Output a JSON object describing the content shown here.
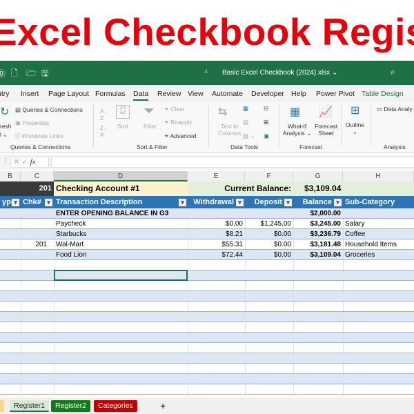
{
  "banner": {
    "title": "Excel Checkbook Register"
  },
  "titlebar": {
    "filename": "Basic Excel Checkbook (2024).xlsx ⌄",
    "search_icon": "search-icon"
  },
  "menu": [
    "ntry",
    "Insert",
    "Page Layout",
    "Formulas",
    "Data",
    "Review",
    "View",
    "Automate",
    "Developer",
    "Help",
    "Power Pivot",
    "Table Design"
  ],
  "ribbon": {
    "refresh": "resh",
    "refresh2": "l ⌄",
    "queries": "Queries & Connections",
    "properties": "Properties",
    "workbook_links": "Workbook Links",
    "group_queries": "Queries & Connections",
    "sort": "Sort",
    "filter": "Filter",
    "clear": "Clear",
    "reapply": "Reapply",
    "advanced": "Advanced",
    "group_sort": "Sort & Filter",
    "text_to": "Text to",
    "columns": "Columns",
    "group_data_tools": "Data Tools",
    "whatif1": "What-If",
    "whatif2": "Analysis ⌄",
    "forecast1": "Forecast",
    "forecast2": "Sheet",
    "group_forecast": "Forecast",
    "outline": "Outline",
    "outline_caret": "⌄",
    "data_analysis": "Data Analy",
    "group_analysis": "Analysis"
  },
  "formula": {
    "fx": "fx",
    "value": ""
  },
  "columns": [
    "B",
    "C",
    "D",
    "E",
    "F",
    "G",
    "H"
  ],
  "row1": {
    "chk": "201",
    "account": "Checking Account #1",
    "balance_label": "Current Balance:",
    "balance": "$3,109.04"
  },
  "headers": [
    "ype",
    "Chk#",
    "Transaction Description",
    "Withdrawal",
    "Deposit",
    "Balance",
    "Sub-Category"
  ],
  "rows": [
    {
      "chk": "",
      "desc": "ENTER OPENING BALANCE IN G3",
      "w": "",
      "d": "",
      "bal": "$2,000.00",
      "sub": ""
    },
    {
      "chk": "",
      "desc": "Paycheck",
      "w": "$0.00",
      "d": "$1,245.00",
      "bal": "$3,245.00",
      "sub": "Salary"
    },
    {
      "chk": "",
      "desc": "Starbucks",
      "w": "$8.21",
      "d": "$0.00",
      "bal": "$3,236.79",
      "sub": "Coffee"
    },
    {
      "chk": "201",
      "desc": "Wal-Mart",
      "w": "$55.31",
      "d": "$0.00",
      "bal": "$3,181.48",
      "sub": "Household Items"
    },
    {
      "chk": "",
      "desc": "Food Lion",
      "w": "$72.44",
      "d": "$0.00",
      "bal": "$3,109.04",
      "sub": "Groceries"
    }
  ],
  "sheet_tabs": [
    {
      "label": "Register1",
      "color": "#d6ead6"
    },
    {
      "label": "Register2",
      "color": "#0f7b1b"
    },
    {
      "label": "Categories",
      "color": "#c00000"
    }
  ],
  "add_sheet": "+",
  "colors": {
    "header_blue": "#2e75b6",
    "band": "#dde7f3",
    "title_red": "#e8000b",
    "excel_green": "#1e7145"
  }
}
